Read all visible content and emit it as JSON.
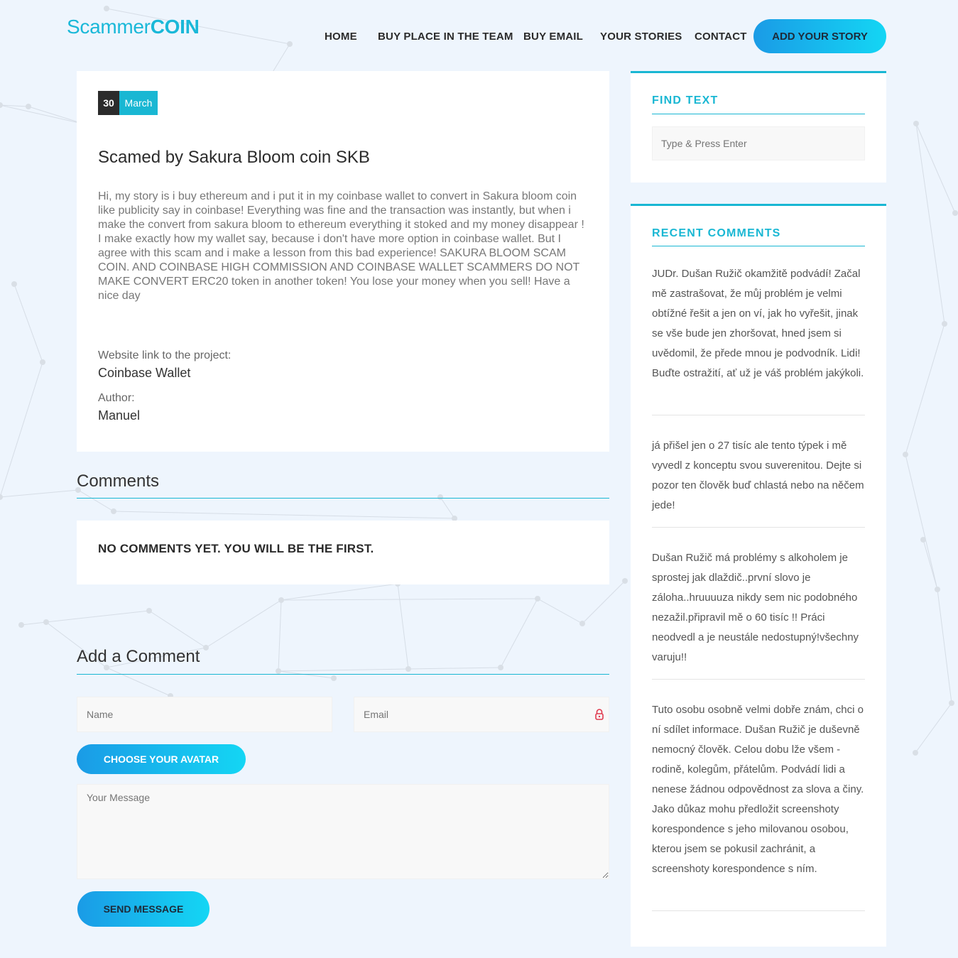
{
  "header": {
    "logo_light": "Scammer",
    "logo_bold": "COIN",
    "nav": [
      "HOME",
      "BUY PLACE IN THE TEAM",
      "BUY EMAIL",
      "YOUR STORIES",
      "CONTACT"
    ],
    "cta_label": "ADD YOUR STORY"
  },
  "post": {
    "day": "30",
    "month": "March",
    "title": "Scamed by Sakura Bloom coin SKB",
    "body": "Hi, my story is i buy ethereum and i put it in my coinbase wallet to convert in Sakura bloom coin like publicity say in coinbase! Everything was fine and the transaction was instantly, but when i make the convert from sakura bloom to ethereum everything it stoked and my money disappear ! I make exactly how my wallet say, because i don't have more option in coinbase wallet. But I agree with this scam and i make a lesson from this bad experience! SAKURA BLOOM SCAM COIN. AND COINBASE HIGH COMMISSION AND COINBASE WALLET SCAMMERS DO NOT MAKE CONVERT ERC20 token in another token! You lose your money when you sell! Have a nice day",
    "website_label": "Website link to the project:",
    "website_value": "Coinbase Wallet",
    "author_label": "Author:",
    "author_value": "Manuel"
  },
  "comments_section": {
    "title": "Comments",
    "empty_text": "NO COMMENTS YET. YOU WILL BE THE FIRST."
  },
  "comment_form": {
    "title": "Add a Comment",
    "name_placeholder": "Name",
    "email_placeholder": "Email",
    "avatar_button": "CHOOSE YOUR AVATAR",
    "message_placeholder": "Your Message",
    "send_button": "SEND MESSAGE"
  },
  "sidebar": {
    "find_title": "FIND TEXT",
    "search_placeholder": "Type & Press Enter",
    "recent_title": "RECENT COMMENTS",
    "recent_comments": [
      "JUDr. Dušan Ružič okamžitě podvádí! Začal mě zastrašovat, že můj problém je velmi obtížné řešit a jen on ví, jak ho vyřešit, jinak se vše bude jen zhoršovat, hned jsem si uvědomil, že přede mnou je podvodník. Lidi! Buďte ostražití, ať už je váš problém jakýkoli.",
      "já přišel jen o 27 tisíc ale tento týpek i mě vyvedl z konceptu svou suverenitou. Dejte si pozor ten člověk buď chlastá nebo na něčem jede!",
      "Dušan Ružič má problémy s alkoholem je sprostej jak dlaždič..první slovo je záloha..hruuuuza nikdy sem nic podobného nezažil.připravil mě o 60 tisíc !! Práci neodvedl a je neustále nedostupný!všechny varuju!!",
      "Tuto osobu osobně velmi dobře znám, chci o ní sdílet informace. Dušan Ružič je duševně nemocný člověk. Celou dobu lže všem - rodině, kolegům, přátelům. Podvádí lidi a nenese žádnou odpovědnost za slova a činy. Jako důkaz mohu předložit screenshoty korespondence s jeho milovanou osobou, kterou jsem se pokusil zachránit, a screenshoty korespondence s ním."
    ]
  },
  "colors": {
    "accent": "#19b7d3",
    "page_bg": "#eef5fd",
    "button_gradient_start": "#1a9be6",
    "button_gradient_end": "#14d6f4",
    "dark": "#2b2b2b"
  },
  "icons": {
    "email_field": "lock-icon"
  }
}
